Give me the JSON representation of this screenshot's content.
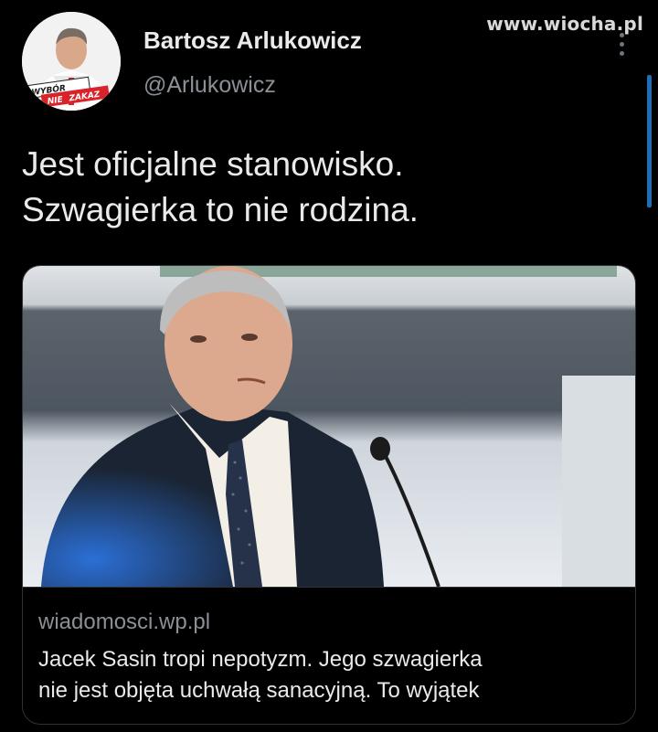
{
  "watermark": "www.wiocha.pl",
  "author": {
    "display_name": "Bartosz Arlukowicz",
    "handle": "@Arlukowicz",
    "avatar_badge": [
      "WYBÓR",
      "NIE",
      "ZAKAZ"
    ]
  },
  "tweet": {
    "lines": [
      "Jest oficjalne stanowisko.",
      "Szwagierka to nie rodzina."
    ]
  },
  "link_card": {
    "domain": "wiadomosci.wp.pl",
    "title_lines": [
      "Jacek Sasin tropi nepotyzm. Jego szwagierka",
      "nie jest objęta uchwałą sanacyjną. To wyjątek"
    ]
  },
  "colors": {
    "background": "#000000",
    "text": "#e9eaeb",
    "secondary_text": "#8b9096",
    "border": "#2f3336",
    "scroll_accent": "#1d6fb8",
    "badge_red": "#d8232a"
  }
}
